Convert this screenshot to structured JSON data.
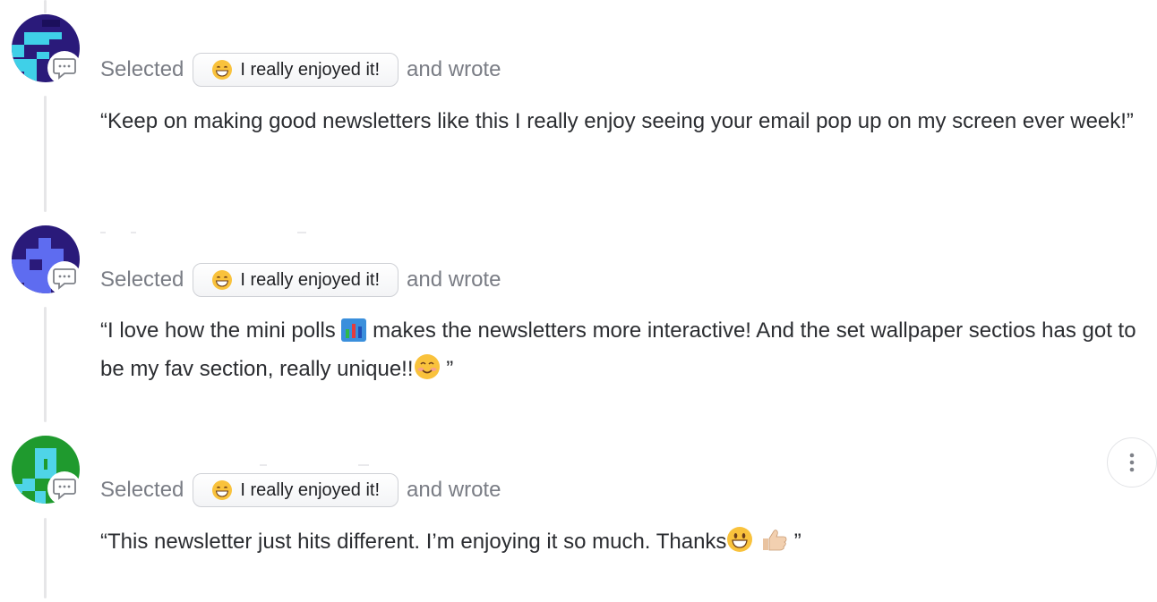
{
  "colors": {
    "text": "#2b2d31",
    "muted": "#7a7d85",
    "thread_line": "#e6e6e8",
    "pill_border": "#cfd1d6"
  },
  "responses": [
    {
      "avatar_icon": "pixel-avatar-cyan-on-navy",
      "selected_label": "Selected",
      "reaction_emoji": "grinning-face-icon",
      "reaction_label": "I really enjoyed it!",
      "wrote_label": "and wrote",
      "quote": "“Keep on making good newsletters like this I really enjoy seeing your email pop up on my screen ever week!”"
    },
    {
      "avatar_icon": "pixel-avatar-blue-on-navy",
      "selected_label": "Selected",
      "reaction_emoji": "grinning-face-icon",
      "reaction_label": "I really enjoyed it!",
      "wrote_label": "and wrote",
      "quote_part1": "“I love how the mini polls",
      "quote_part2": "makes the newsletters more interactive! And the set wallpaper sectios has got to be my fav section, really unique!!",
      "quote_end": "”"
    },
    {
      "avatar_icon": "pixel-avatar-cyan-on-green",
      "selected_label": "Selected",
      "reaction_emoji": "grinning-face-icon",
      "reaction_label": "I really enjoyed it!",
      "wrote_label": "and wrote",
      "quote_part1": "“This newsletter just hits different. I’m enjoying it so much. Thanks",
      "quote_end": "”"
    }
  ]
}
